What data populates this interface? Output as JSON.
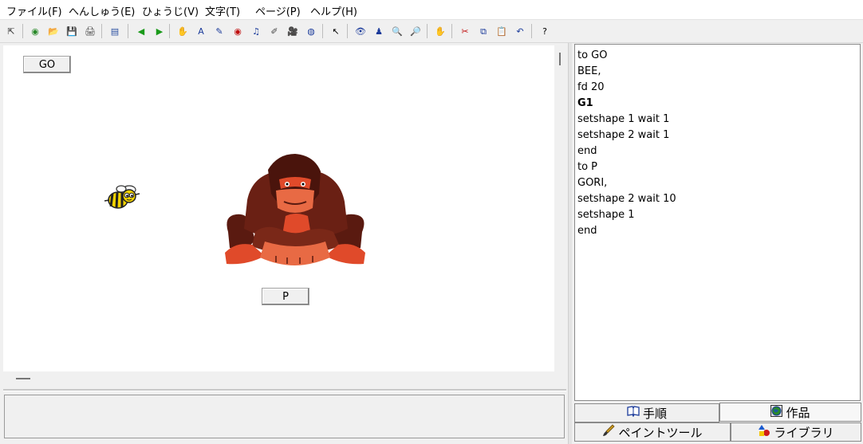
{
  "menu": [
    "ファイル(F)",
    "へんしゅう(E)",
    "ひょうじ(V)",
    "文字(T)",
    "ページ(P)",
    "ヘルプ(H)"
  ],
  "toolbar": {
    "icons": [
      "pointer-small-icon",
      "world-icon",
      "open-folder-icon",
      "save-disk-icon",
      "print-icon",
      "page-view-icon",
      "back-arrow-icon",
      "forward-arrow-icon",
      "turtle-hand-icon",
      "text-box-icon",
      "pencil-line-icon",
      "eye-red-icon",
      "music-note-icon",
      "brush-icon",
      "camera-icon",
      "globe-stamp-icon",
      "arrow-cursor-icon",
      "look-eye-icon",
      "person-stamp-icon",
      "zoom-in-icon",
      "zoom-out-icon",
      "stop-hand-icon",
      "cut-scissors-icon",
      "copy-icon",
      "paste-icon",
      "undo-icon",
      "help-icon"
    ],
    "glyphs": [
      "⇱",
      "◉",
      "📂",
      "💾",
      "🖨",
      "▤",
      "◀",
      "▶",
      "✋",
      "A",
      "✎",
      "◉",
      "♫",
      "✐",
      "🎥",
      "◍",
      "↖",
      "👁",
      "♟",
      "🔍",
      "🔎",
      "✋",
      "✂",
      "⧉",
      "📋",
      "↶",
      "?"
    ],
    "colors": [
      "#333",
      "#2a8a2a",
      "#c99a1e",
      "#333",
      "#444",
      "#2a4fa0",
      "#1a9a1a",
      "#1a9a1a",
      "#2a8a2a",
      "#1a3a9a",
      "#1a3a9a",
      "#c01010",
      "#1a3a9a",
      "#444",
      "#333",
      "#1a3a9a",
      "#000",
      "#1a3a9a",
      "#1a3a9a",
      "#1a3a9a",
      "#1a3a9a",
      "#c01010",
      "#c01010",
      "#1a3a9a",
      "#1a3a9a",
      "#1a3a9a",
      "#000"
    ]
  },
  "stage": {
    "go_button": "GO",
    "p_button": "P",
    "bee_sprite": "bee",
    "gorilla_sprite": "gorilla"
  },
  "editor": {
    "lines": [
      {
        "text": "to GO",
        "bold": false
      },
      {
        "text": "BEE,",
        "bold": false
      },
      {
        "text": "fd 20",
        "bold": false
      },
      {
        "text": "G1",
        "bold": true
      },
      {
        "text": "setshape 1 wait 1",
        "bold": false
      },
      {
        "text": "setshape 2 wait 1",
        "bold": false
      },
      {
        "text": "end",
        "bold": false
      },
      {
        "text": "to P",
        "bold": false
      },
      {
        "text": "GORI,",
        "bold": false
      },
      {
        "text": "setshape 2 wait 10",
        "bold": false
      },
      {
        "text": "setshape 1",
        "bold": false
      },
      {
        "text": "end",
        "bold": false
      }
    ]
  },
  "tabs": {
    "procedure": "手順",
    "works": "作品",
    "paint_tool": "ペイントツール",
    "library": "ライブラリ"
  },
  "colors": {
    "bee_yellow": "#f5d400",
    "gorilla_dark": "#5a1a10",
    "gorilla_red": "#e04a2a"
  }
}
